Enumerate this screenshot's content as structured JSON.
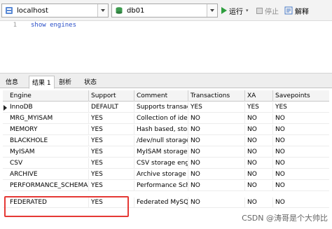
{
  "toolbar": {
    "connection": "localhost",
    "database": "db01",
    "run_label": "运行",
    "stop_label": "停止",
    "explain_label": "解释"
  },
  "editor": {
    "line_number": "1",
    "query": "show engines"
  },
  "tabs": [
    {
      "label": "信息"
    },
    {
      "label": "结果 1"
    },
    {
      "label": "剖析"
    },
    {
      "label": "状态"
    }
  ],
  "grid": {
    "columns": [
      "Engine",
      "Support",
      "Comment",
      "Transactions",
      "XA",
      "Savepoints"
    ],
    "rows": [
      [
        "InnoDB",
        "DEFAULT",
        "Supports transac",
        "YES",
        "YES",
        "YES"
      ],
      [
        "MRG_MYISAM",
        "YES",
        "Collection of ider",
        "NO",
        "NO",
        "NO"
      ],
      [
        "MEMORY",
        "YES",
        "Hash based, stor",
        "NO",
        "NO",
        "NO"
      ],
      [
        "BLACKHOLE",
        "YES",
        "/dev/null storage",
        "NO",
        "NO",
        "NO"
      ],
      [
        "MyISAM",
        "YES",
        "MyISAM storage",
        "NO",
        "NO",
        "NO"
      ],
      [
        "CSV",
        "YES",
        "CSV storage eng",
        "NO",
        "NO",
        "NO"
      ],
      [
        "ARCHIVE",
        "YES",
        "Archive storage",
        "NO",
        "NO",
        "NO"
      ],
      [
        "PERFORMANCE_SCHEMA",
        "YES",
        "Performance Sch",
        "NO",
        "NO",
        "NO"
      ],
      [
        "FEDERATED",
        "YES",
        "Federated MySQ",
        "NO",
        "NO",
        "NO"
      ]
    ]
  },
  "highlight_color": "#e53935",
  "watermark": "CSDN @涛哥是个大帅比"
}
